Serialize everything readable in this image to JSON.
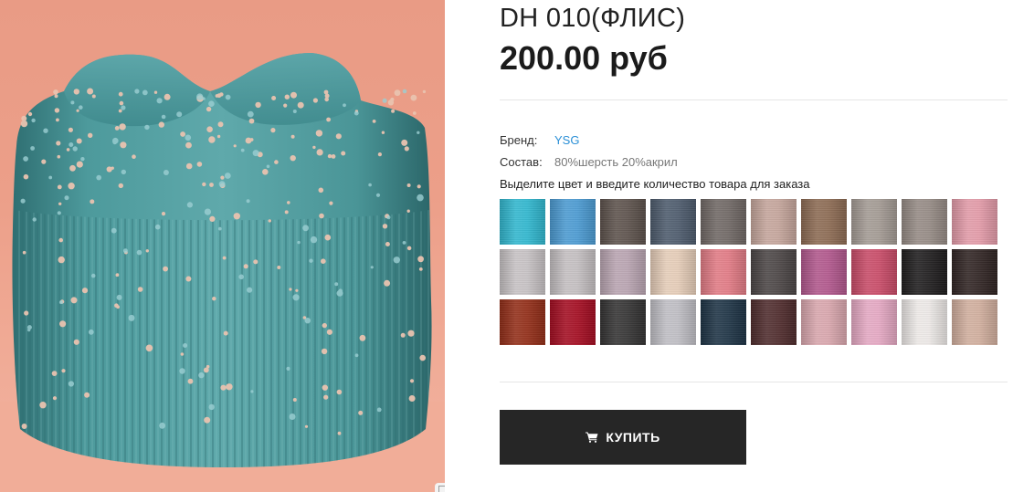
{
  "product": {
    "title": "DH 010(ФЛИС)",
    "price": "200.00 руб",
    "image": {
      "subject": "hat-image",
      "background_color": "#ec9f89",
      "hat_color": "#4f9a9c"
    }
  },
  "meta": {
    "brand_label": "Бренд:",
    "brand_value": "YSG",
    "composition_label": "Состав:",
    "composition_value": "80%шерсть 20%акрил"
  },
  "instruction": "Выделите цвет и введите количество товара для заказа",
  "swatches": [
    "#2fb7cf",
    "#4a9ad2",
    "#5c514b",
    "#4c5a6c",
    "#6f6764",
    "#c5a59b",
    "#8c6a52",
    "#a39a93",
    "#958a84",
    "#e39aa8",
    "#c7c2c4",
    "#c4bfc1",
    "#b9a4b1",
    "#e6cdb8",
    "#e27a84",
    "#4a4444",
    "#b1568c",
    "#c94a67",
    "#1d1b1c",
    "#2e2221",
    "#922c16",
    "#a40b20",
    "#333232",
    "#bfbec4",
    "#1c3244",
    "#4e2a2b",
    "#d9a6ad",
    "#e5a8c3",
    "#ede9e7",
    "#d1ae9d"
  ],
  "buy": {
    "label": "КУПИТЬ",
    "icon": "cart-icon",
    "color": "#262626"
  },
  "colors": {
    "link": "#2a8fd6",
    "divider": "#e6e6e6"
  }
}
